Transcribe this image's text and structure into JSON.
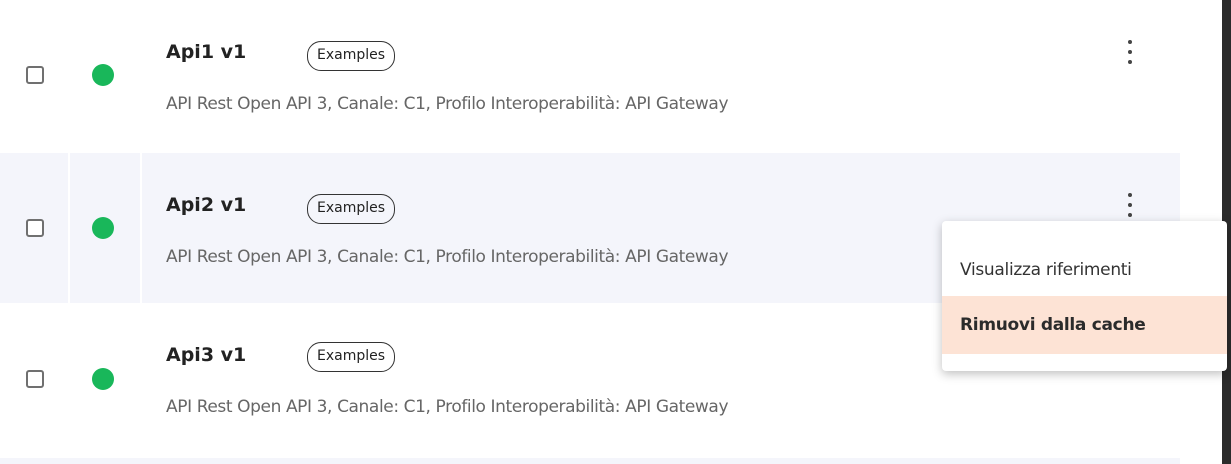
{
  "apis": [
    {
      "title": "Api1 v1",
      "tag": "Examples",
      "description": "API Rest Open API 3, Canale: C1, Profilo Interoperabilità: API Gateway",
      "status": "active"
    },
    {
      "title": "Api2 v1",
      "tag": "Examples",
      "description": "API Rest Open API 3, Canale: C1, Profilo Interoperabilità: API Gateway",
      "status": "active"
    },
    {
      "title": "Api3 v1",
      "tag": "Examples",
      "description": "API Rest Open API 3, Canale: C1, Profilo Interoperabilità: API Gateway",
      "status": "active"
    }
  ],
  "context_menu": {
    "items": [
      {
        "label": "Visualizza riferimenti"
      },
      {
        "label": "Rimuovi dalla cache",
        "highlighted": true
      }
    ]
  },
  "colors": {
    "status_active": "#19b75a",
    "row_alt_background": "#f4f5fb",
    "menu_highlight": "#fde3d5"
  },
  "icons": {
    "row_menu": "more-vertical-icon",
    "status": "status-dot-icon"
  }
}
